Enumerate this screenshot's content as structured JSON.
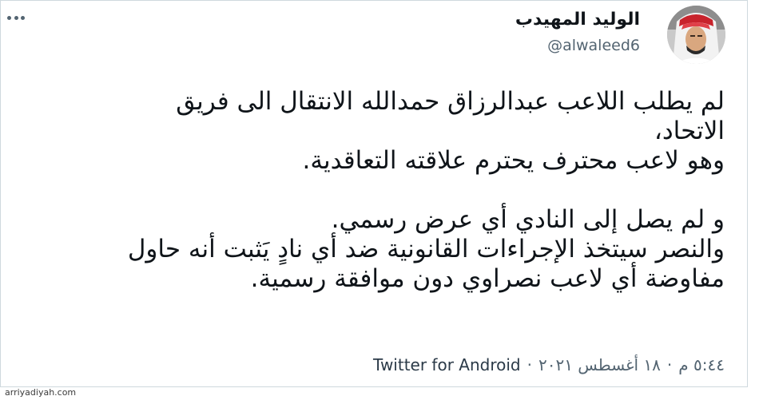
{
  "tweet": {
    "author_name": "الوليد المهيدب",
    "author_handle": "@alwaleed6",
    "lines": [
      "لم يطلب اللاعب عبدالرزاق حمدالله الانتقال الى فريق",
      "الاتحاد،",
      "وهو لاعب محترف يحترم علاقته التعاقدية.",
      "و لم يصل إلى النادي أي عرض رسمي.",
      "والنصر سيتخذ الإجراءات القانونية ضد أي نادٍ يَثبت أنه حاول",
      "مفاوضة أي لاعب نصراوي دون موافقة رسمية."
    ],
    "timestamp": "٥:٤٤ م",
    "date": "١٨ أغسطس ٢٠٢١",
    "separator": "·",
    "source": "Twitter for Android"
  },
  "watermark": "arriyadiyah.com",
  "icons": {
    "more": "more-dots-icon"
  },
  "colors": {
    "text_primary": "#0f1419",
    "text_secondary": "#536471",
    "border": "#cfd9de"
  }
}
